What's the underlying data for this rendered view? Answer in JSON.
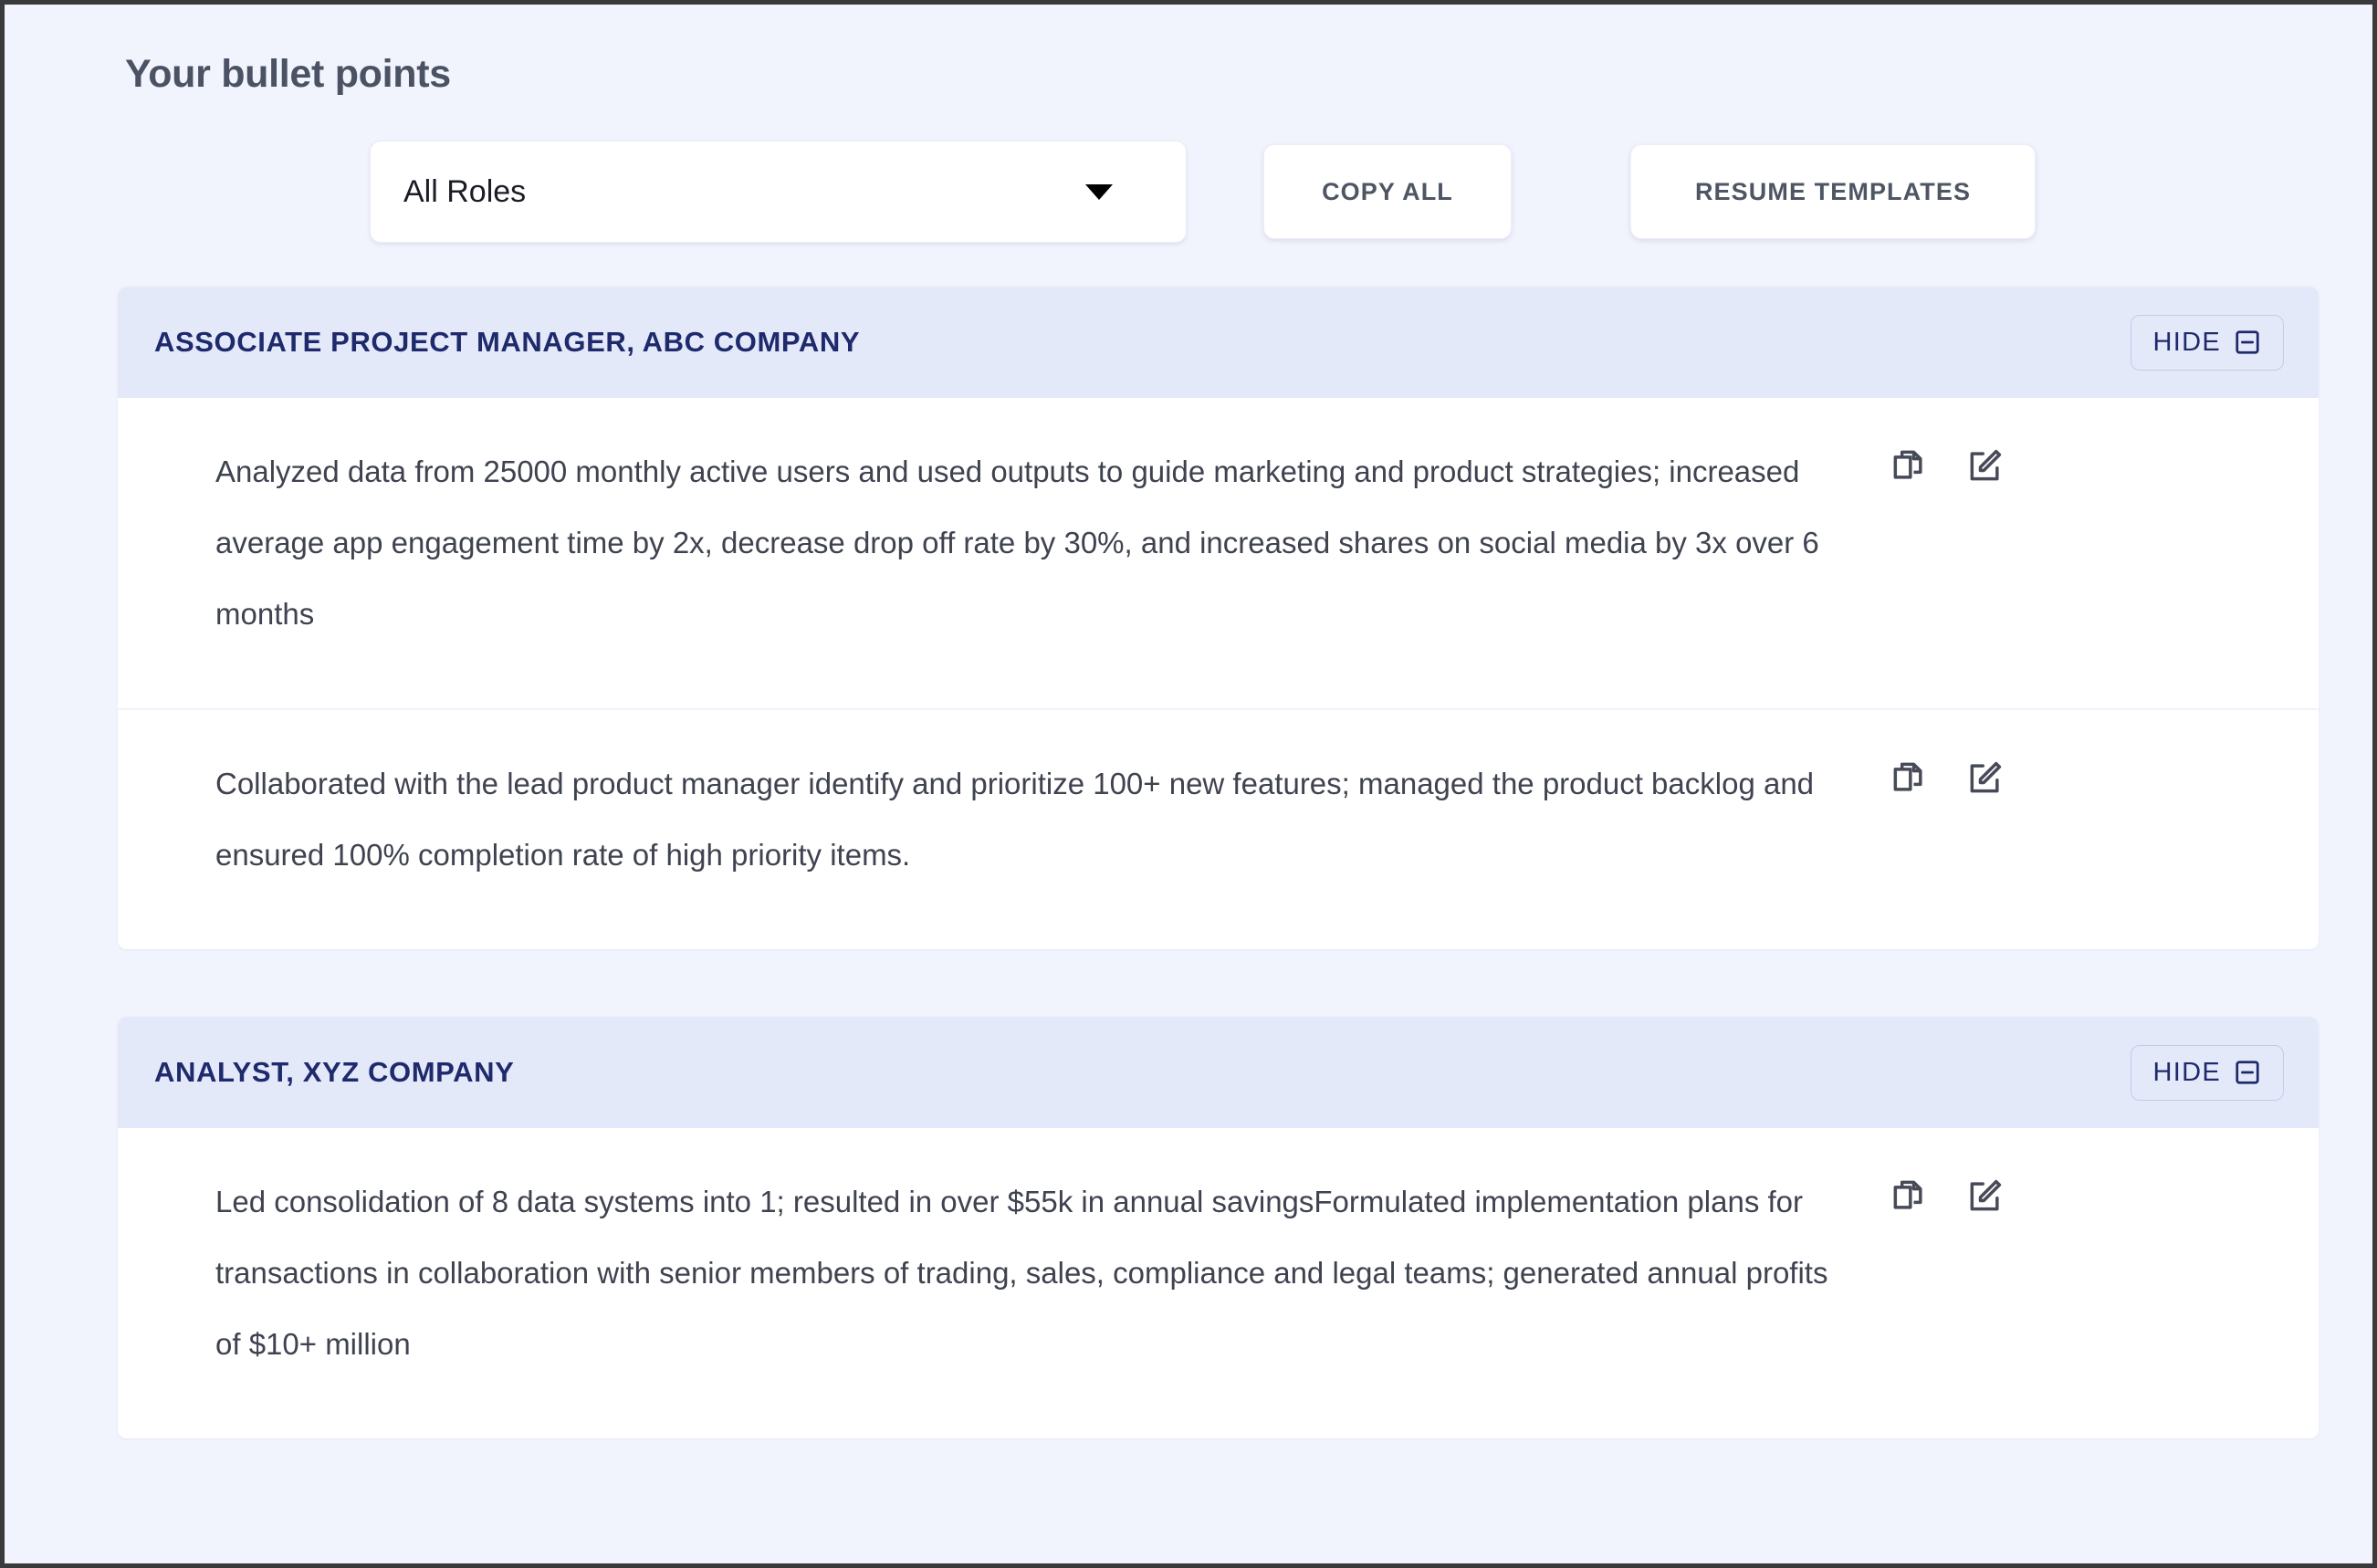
{
  "page": {
    "title": "Your bullet points"
  },
  "toolbar": {
    "role_filter": {
      "selected": "All Roles",
      "icon": "chevron-down-icon"
    },
    "copy_all_label": "COPY ALL",
    "resume_templates_label": "RESUME TEMPLATES"
  },
  "colors": {
    "page_background": "#f1f4fd",
    "section_header_background": "#e4e9fa",
    "section_header_text": "#1e2a6b",
    "body_text": "#3f4350",
    "title_text": "#4b5263",
    "card_background": "#ffffff"
  },
  "sections": [
    {
      "title": "ASSOCIATE PROJECT MANAGER, ABC COMPANY",
      "hide_label": "HIDE",
      "hide_icon": "minus-square-icon",
      "bullets": [
        {
          "text": "Analyzed data from 25000 monthly active users and used outputs to guide marketing and product strategies; increased average app engagement time by 2x, decrease drop off rate by 30%, and increased shares on social media by 3x over 6 months",
          "copy_icon": "copy-icon",
          "edit_icon": "edit-icon"
        },
        {
          "text": "Collaborated with the lead product manager identify and prioritize 100+ new features; managed the product backlog and ensured 100% completion rate of high priority items.",
          "copy_icon": "copy-icon",
          "edit_icon": "edit-icon"
        }
      ]
    },
    {
      "title": "ANALYST, XYZ COMPANY",
      "hide_label": "HIDE",
      "hide_icon": "minus-square-icon",
      "bullets": [
        {
          "text": "Led consolidation of 8 data systems into 1; resulted in over $55k in annual savingsFormulated implementation plans for transactions in collaboration with senior members of trading, sales, compliance and legal teams; generated annual profits of $10+ million",
          "copy_icon": "copy-icon",
          "edit_icon": "edit-icon"
        }
      ]
    }
  ]
}
